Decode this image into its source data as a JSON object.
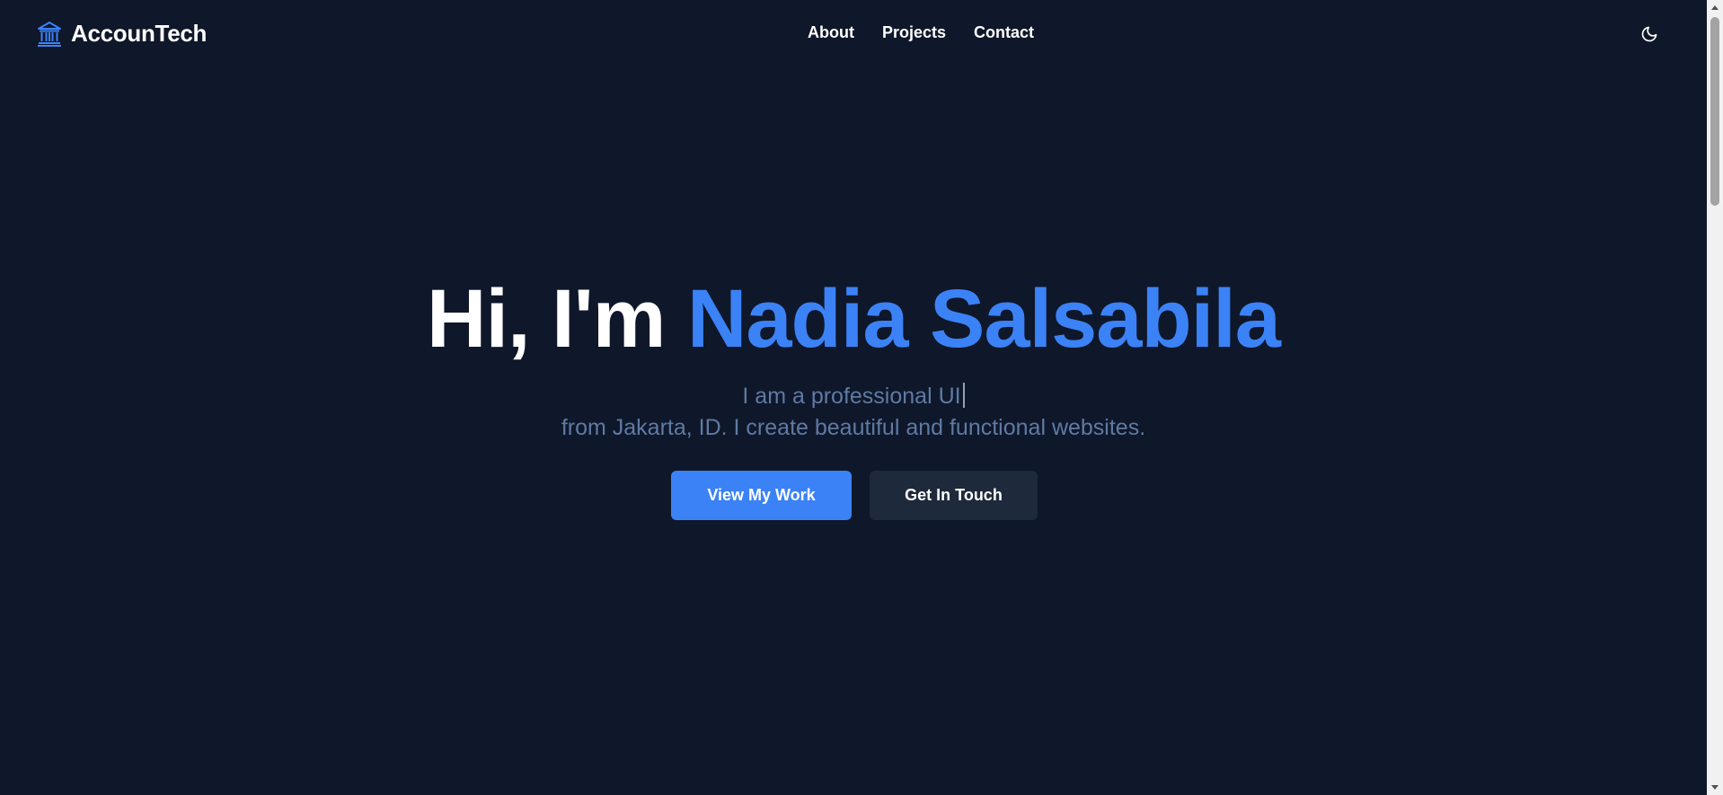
{
  "header": {
    "brand_name": "AccounTech",
    "nav": {
      "about": "About",
      "projects": "Projects",
      "contact": "Contact"
    }
  },
  "hero": {
    "greeting": "Hi, I'm ",
    "name": "Nadia Salsabila",
    "subtitle_line1": "I am a professional UI",
    "subtitle_line2": "from Jakarta, ID. I create beautiful and functional websites.",
    "primary_button": "View My Work",
    "secondary_button": "Get In Touch"
  },
  "colors": {
    "background": "#0f172a",
    "accent": "#3b82f6",
    "secondary_button": "#1e293b",
    "subtitle_text": "#5f7aa3"
  },
  "icons": {
    "brand": "bank-building-icon",
    "theme_toggle": "moon-icon"
  }
}
